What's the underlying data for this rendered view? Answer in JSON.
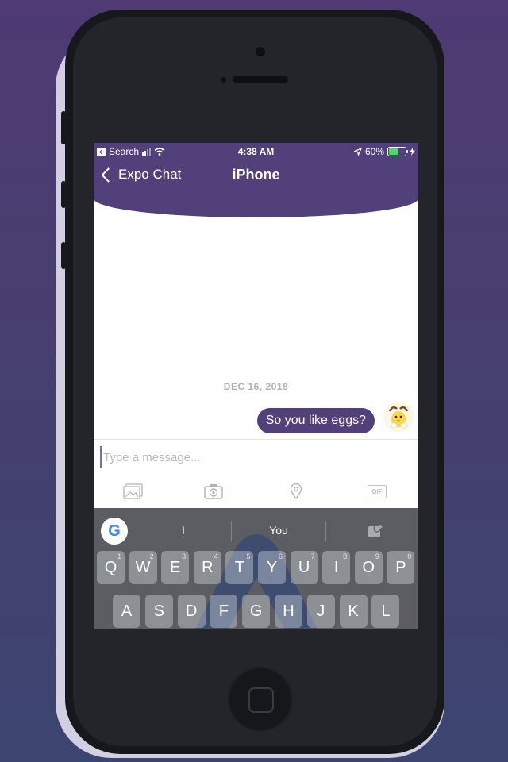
{
  "status_bar": {
    "back_app": "Search",
    "time": "4:38 AM",
    "battery_percent": "60%",
    "battery_level": 0.6
  },
  "nav": {
    "back_label": "Expo Chat",
    "title": "iPhone"
  },
  "chat": {
    "date_separator": "DEC 16, 2018",
    "messages": [
      {
        "text": "So you like eggs?",
        "from": "me"
      }
    ]
  },
  "composer": {
    "placeholder": "Type a message...",
    "value": "",
    "tools": [
      "image-icon",
      "camera-icon",
      "location-icon",
      "gif-icon"
    ],
    "gif_label": "GIF"
  },
  "keyboard": {
    "logo": "G",
    "suggestions": [
      "I",
      "You"
    ],
    "row1": [
      {
        "key": "Q",
        "hint": "1"
      },
      {
        "key": "W",
        "hint": "2"
      },
      {
        "key": "E",
        "hint": "3"
      },
      {
        "key": "R",
        "hint": "4"
      },
      {
        "key": "T",
        "hint": "5"
      },
      {
        "key": "Y",
        "hint": "6"
      },
      {
        "key": "U",
        "hint": "7"
      },
      {
        "key": "I",
        "hint": "8"
      },
      {
        "key": "O",
        "hint": "9"
      },
      {
        "key": "P",
        "hint": "0"
      }
    ],
    "row2": [
      "A",
      "S",
      "D",
      "F",
      "G",
      "H",
      "J",
      "K",
      "L"
    ]
  },
  "colors": {
    "accent": "#52407a",
    "background": "#4a3d72",
    "battery": "#4cd964"
  }
}
